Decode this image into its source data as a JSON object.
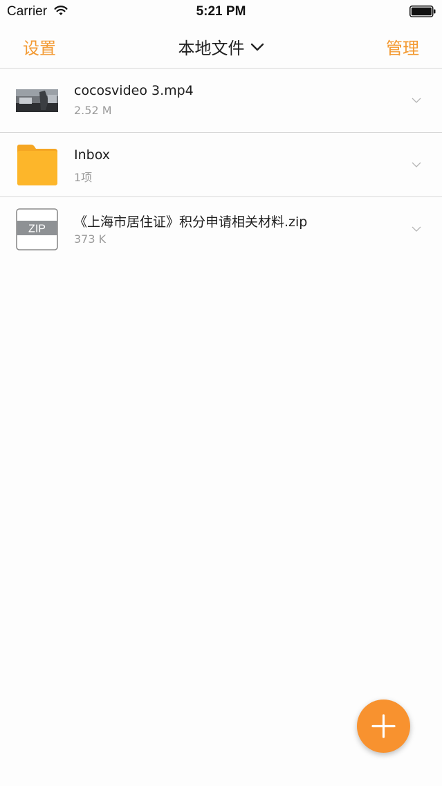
{
  "status_bar": {
    "carrier": "Carrier",
    "time": "5:21 PM"
  },
  "nav": {
    "left_label": "设置",
    "title": "本地文件",
    "right_label": "管理"
  },
  "files": [
    {
      "name": "cocosvideo 3.mp4",
      "meta": "2.52 M",
      "icon": "video-thumbnail"
    },
    {
      "name": "Inbox",
      "meta": "1项",
      "icon": "folder-icon"
    },
    {
      "name": "《上海市居住证》积分申请相关材料.zip",
      "meta": "373 K",
      "icon": "zip-file-icon",
      "icon_label": "ZIP"
    }
  ],
  "colors": {
    "accent": "#f39a33",
    "fab": "#f8922f",
    "folder": "#fdb62a"
  },
  "fab": {
    "icon": "plus-icon"
  }
}
